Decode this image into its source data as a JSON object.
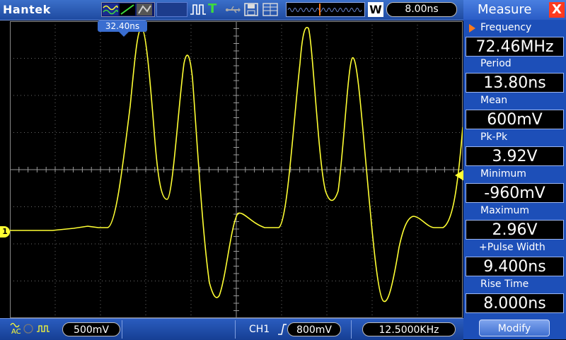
{
  "brand": "Hantek",
  "timebase": "8.00ns",
  "w_label": "W",
  "trigger_mode_letter": "T",
  "cursor_label": "32.40ns",
  "channel_marker": "1",
  "bottom": {
    "coupling": "AC",
    "volts_div": "500mV",
    "trigger_channel": "CH1",
    "trigger_level": "800mV",
    "frequency": "12.5000KHz"
  },
  "measure": {
    "title": "Measure",
    "close": "X",
    "items": [
      {
        "label": "Frequency",
        "value": "72.46MHz"
      },
      {
        "label": "Period",
        "value": "13.80ns"
      },
      {
        "label": "Mean",
        "value": "600mV"
      },
      {
        "label": "Pk-Pk",
        "value": "3.92V"
      },
      {
        "label": "Minimum",
        "value": "-960mV"
      },
      {
        "label": "Maximum",
        "value": "2.96V"
      },
      {
        "label": "+Pulse Width",
        "value": "9.400ns"
      },
      {
        "label": "Rise Time",
        "value": "8.000ns"
      }
    ],
    "modify": "Modify"
  },
  "colors": {
    "trace": "#ffff33",
    "grid": "#6a6a6a",
    "accent": "#1d4fb8",
    "close": "#ff3b1f"
  }
}
